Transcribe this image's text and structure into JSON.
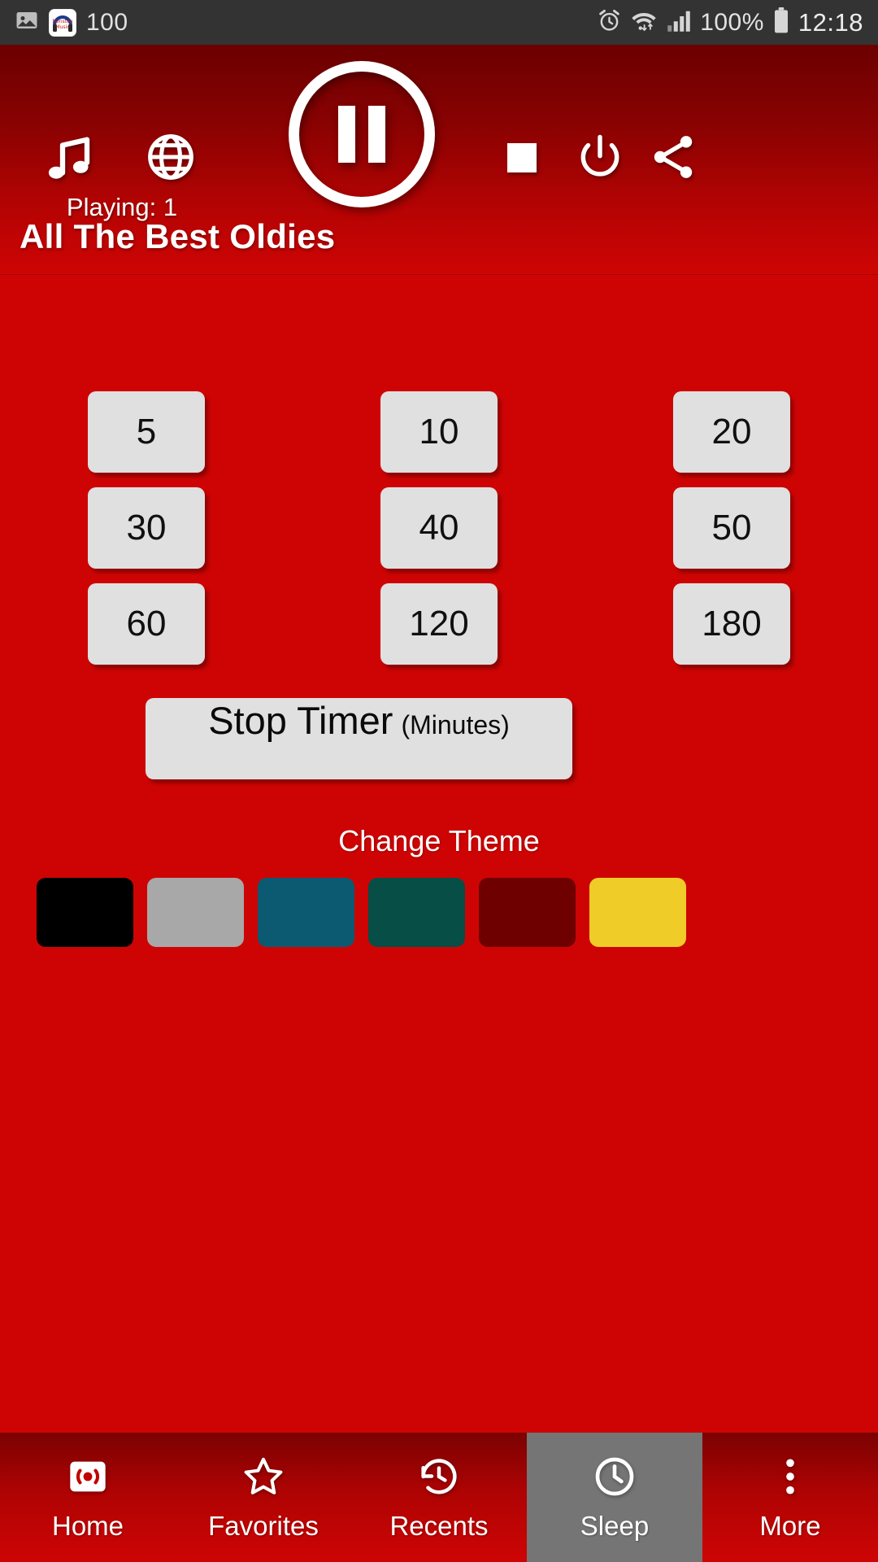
{
  "status_bar": {
    "left_icons": [
      {
        "name": "image-icon",
        "label": "image"
      },
      {
        "name": "app-notification-icon",
        "label": "Nonstop Music"
      }
    ],
    "notification_count": "100",
    "right_icons": [
      {
        "name": "alarm-icon",
        "label": "alarm"
      },
      {
        "name": "wifi-icon",
        "label": "wifi"
      },
      {
        "name": "signal-icon",
        "label": "signal"
      }
    ],
    "battery_percent": "100%",
    "time": "12:18"
  },
  "header": {
    "music_icon": "music-note-icon",
    "globe_icon": "globe-icon",
    "playing_status": "Playing: 1",
    "play_pause_icon": "pause-icon",
    "stop_icon": "stop-icon",
    "power_icon": "power-icon",
    "share_icon": "share-icon",
    "station_title": "All The Best Oldies",
    "gradient_top": "#6B0000",
    "gradient_bottom": "#CE0404"
  },
  "sleep": {
    "timer_options": [
      "5",
      "10",
      "20",
      "30",
      "40",
      "50",
      "60",
      "120",
      "180"
    ],
    "stop_timer_label": "Stop Timer",
    "stop_timer_unit": "(Minutes)",
    "change_theme_label": "Change Theme",
    "themes": [
      {
        "name": "theme-black",
        "color": "#000000"
      },
      {
        "name": "theme-gray",
        "color": "#A8A8A8"
      },
      {
        "name": "theme-teal",
        "color": "#0B5A72"
      },
      {
        "name": "theme-green",
        "color": "#064E46"
      },
      {
        "name": "theme-maroon",
        "color": "#6E0000"
      },
      {
        "name": "theme-yellow",
        "color": "#F0CC28"
      }
    ]
  },
  "bottom_nav": {
    "active_index": 3,
    "items": [
      {
        "name": "home",
        "label": "Home",
        "icon": "radio-icon"
      },
      {
        "name": "favorites",
        "label": "Favorites",
        "icon": "star-icon"
      },
      {
        "name": "recents",
        "label": "Recents",
        "icon": "history-icon"
      },
      {
        "name": "sleep",
        "label": "Sleep",
        "icon": "clock-icon"
      },
      {
        "name": "more",
        "label": "More",
        "icon": "dots-vertical-icon"
      }
    ]
  },
  "colors": {
    "background": "#CE0404",
    "button": "#E0E0E0",
    "active_nav": "#757575",
    "status_bar": "#333333"
  }
}
